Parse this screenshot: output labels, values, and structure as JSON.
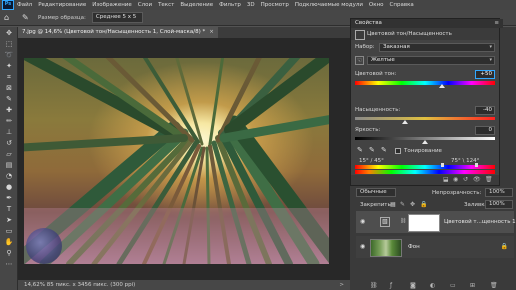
{
  "app": {
    "logo": "Ps"
  },
  "menu": [
    "Файл",
    "Редактирование",
    "Изображение",
    "Слои",
    "Текст",
    "Выделение",
    "Фильтр",
    "3D",
    "Просмотр",
    "Подключаемые модули",
    "Окно",
    "Справка"
  ],
  "options": {
    "sample_label": "Размер образца:",
    "sample_value": "Среднее 5 х 5"
  },
  "document": {
    "tab_title": "7.jpg @ 14,6% (Цветовой тон/Насыщенность 1, Слой-маска/8) *",
    "close": "×"
  },
  "status": {
    "text": "14,62%   85 пикс. х 3456 пикс. (300 ppi)",
    "arrow": ">"
  },
  "properties": {
    "panel_title": "Свойства",
    "adjustment_name": "Цветовой тон/Насыщенность",
    "preset_label": "Набор:",
    "preset_value": "Заказная",
    "channel_value": "Желтые",
    "hue_label": "Цветовой тон:",
    "hue_value": "+50",
    "saturation_label": "Насыщенность:",
    "saturation_value": "-40",
    "lightness_label": "Яркость:",
    "lightness_value": "0",
    "colorize_label": "Тонирование",
    "range_left": "15° / 45°",
    "range_right": "75° \\ 124°"
  },
  "sliders": {
    "hue_position": 0.62,
    "saturation_position": 0.36,
    "lightness_position": 0.5
  },
  "layers": {
    "blend_mode": "Обычные",
    "opacity_label": "Непрозрачность:",
    "opacity_value": "100%",
    "lock_label": "Закрепить:",
    "fill_label": "Заливка:",
    "fill_value": "100%",
    "items": [
      {
        "name": "Цветовой т...щенность 1"
      },
      {
        "name": "Фон"
      }
    ]
  },
  "colors": {
    "accent": "#31a8ff",
    "panel": "#434343",
    "workspace": "#535353"
  }
}
